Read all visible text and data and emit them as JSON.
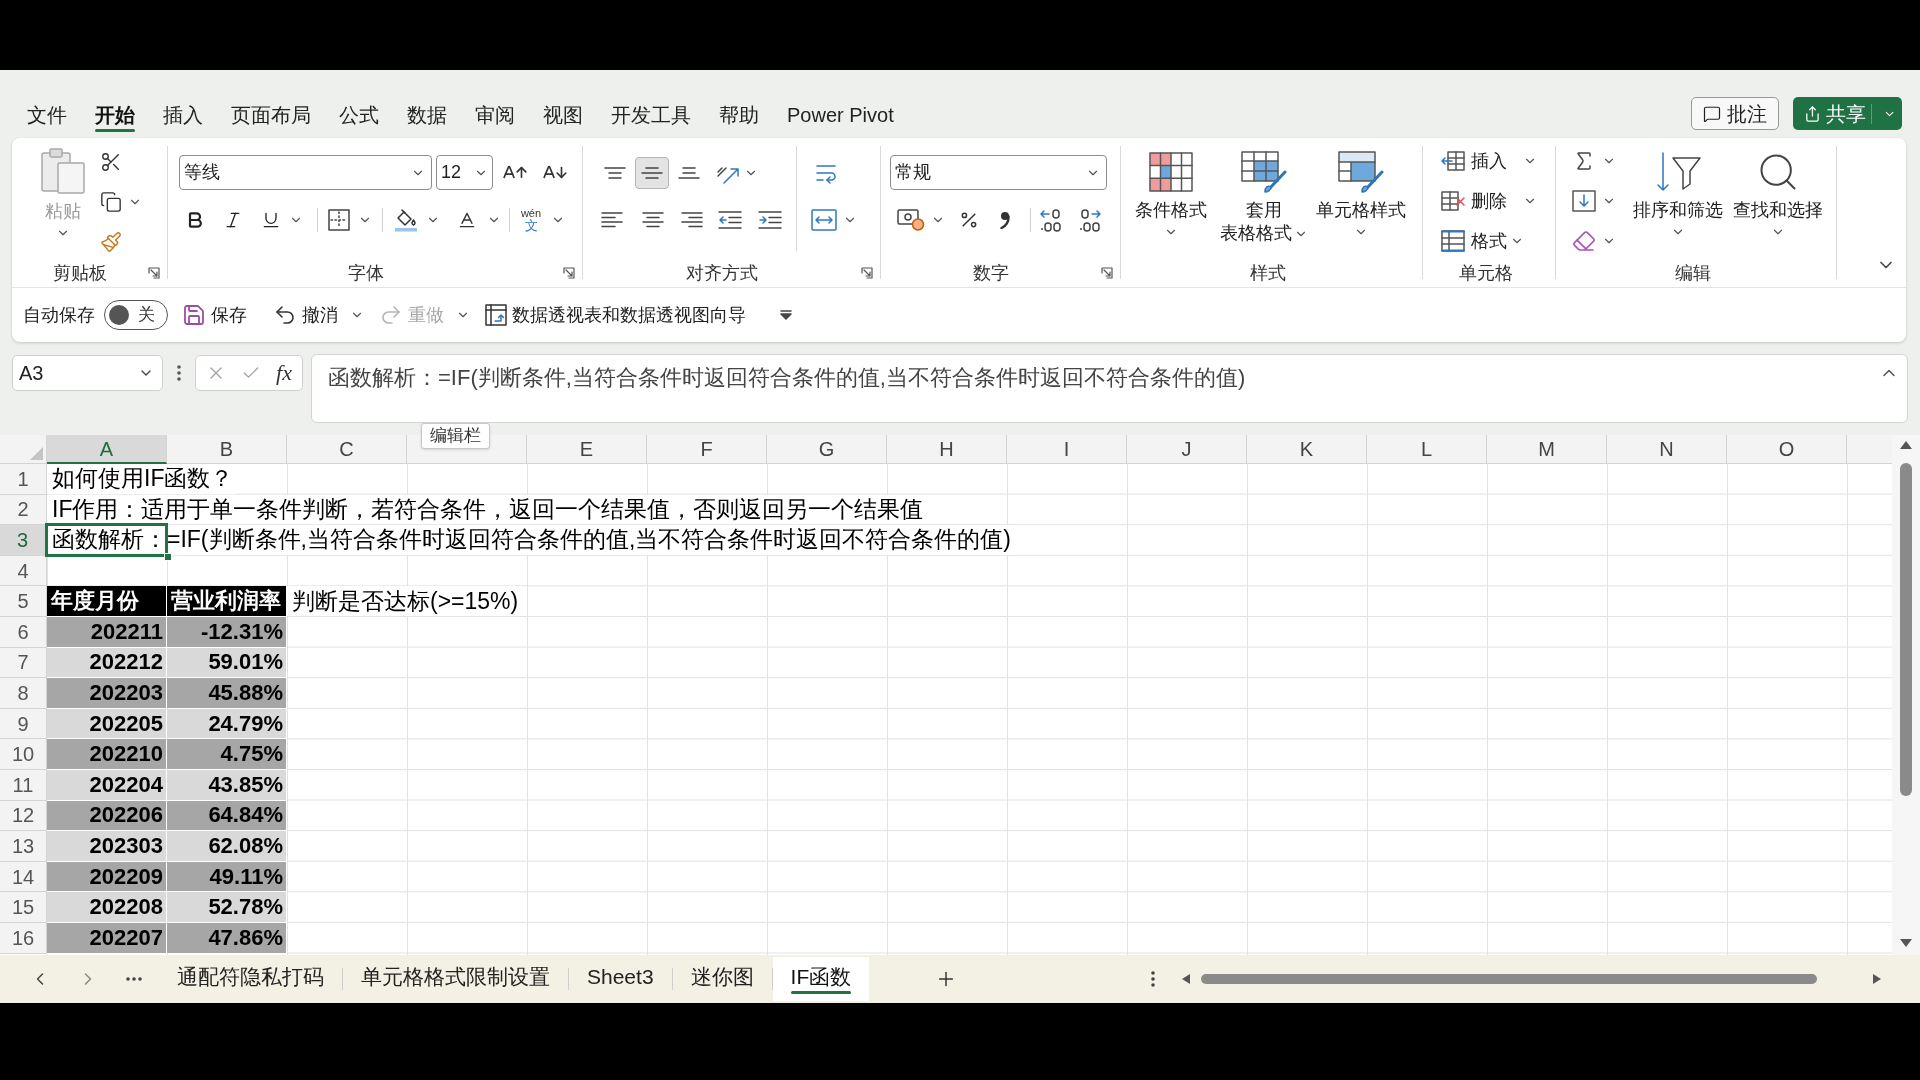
{
  "menu_tabs": [
    {
      "label": "文件",
      "selected": false
    },
    {
      "label": "开始",
      "selected": true
    },
    {
      "label": "插入",
      "selected": false
    },
    {
      "label": "页面布局",
      "selected": false
    },
    {
      "label": "公式",
      "selected": false
    },
    {
      "label": "数据",
      "selected": false
    },
    {
      "label": "审阅",
      "selected": false
    },
    {
      "label": "视图",
      "selected": false
    },
    {
      "label": "开发工具",
      "selected": false
    },
    {
      "label": "帮助",
      "selected": false
    },
    {
      "label": "Power Pivot",
      "selected": false
    }
  ],
  "header_buttons": [
    {
      "kind": "comment",
      "label": "批注"
    },
    {
      "kind": "share",
      "label": "共享"
    }
  ],
  "ribbon": {
    "clipboard": {
      "label": "剪贴板",
      "paste": {
        "label": "粘贴",
        "disabled": true
      }
    },
    "font": {
      "label": "字体",
      "font_name": "等线",
      "font_size": "12",
      "phonetic": {
        "pinyin": "wén",
        "char": "文"
      }
    },
    "alignment": {
      "label": "对齐方式",
      "vertical": [
        {
          "kind": "top",
          "selected": false
        },
        {
          "kind": "middle",
          "selected": true
        },
        {
          "kind": "bottom",
          "selected": false
        }
      ]
    },
    "number": {
      "label": "数字",
      "format": "常规"
    },
    "styles": {
      "label": "样式",
      "buttons": [
        {
          "kind": "conditional",
          "lines": [
            "条件格式"
          ]
        },
        {
          "kind": "table",
          "lines": [
            "套用",
            "表格格式"
          ]
        },
        {
          "kind": "cell_styles",
          "lines": [
            "单元格样式"
          ]
        }
      ]
    },
    "cells": {
      "label": "单元格",
      "buttons": [
        {
          "kind": "insert",
          "label": "插入"
        },
        {
          "kind": "delete",
          "label": "删除"
        },
        {
          "kind": "format",
          "label": "格式"
        }
      ]
    },
    "editing": {
      "label": "编辑",
      "buttons": [
        {
          "kind": "sort_filter",
          "label": "排序和筛选"
        },
        {
          "kind": "find_select",
          "label": "查找和选择"
        }
      ]
    }
  },
  "quick_access": {
    "autosave": {
      "label": "自动保存",
      "on": false,
      "state": "关"
    },
    "items": [
      {
        "kind": "save",
        "label": "保存",
        "disabled": false
      },
      {
        "kind": "undo",
        "label": "撤消",
        "disabled": false
      },
      {
        "kind": "redo",
        "label": "重做",
        "disabled": true
      },
      {
        "kind": "pivot_wizard",
        "label": "数据透视表和数据透视图向导",
        "disabled": false
      }
    ]
  },
  "formula_bar": {
    "name_box": "A3",
    "function_label": "fx",
    "formula": "函数解析：=IF(判断条件,当符合条件时返回符合条件的值,当不符合条件时返回不符合条件的值)",
    "tooltip": "编辑栏"
  },
  "sheet": {
    "columns": [
      {
        "label": "A",
        "selected": true
      },
      {
        "label": "B",
        "selected": false
      },
      {
        "label": "C",
        "selected": false
      },
      {
        "selected": false
      },
      {
        "label": "E",
        "selected": false
      },
      {
        "label": "F",
        "selected": false
      },
      {
        "label": "G",
        "selected": false
      },
      {
        "label": "H",
        "selected": false
      },
      {
        "label": "I",
        "selected": false
      },
      {
        "label": "J",
        "selected": false
      },
      {
        "label": "K",
        "selected": false
      },
      {
        "label": "L",
        "selected": false
      },
      {
        "label": "M",
        "selected": false
      },
      {
        "label": "N",
        "selected": false
      },
      {
        "label": "O",
        "selected": false
      }
    ],
    "rows": [
      {
        "number": "1",
        "selected": false,
        "cells": [
          {
            "kind": "text",
            "text": "如何使用IF函数？",
            "selected": false
          }
        ]
      },
      {
        "number": "2",
        "selected": false,
        "cells": [
          {
            "kind": "text",
            "text": "IF作用：适用于单一条件判断，若符合条件，返回一个结果值，否则返回另一个结果值",
            "selected": false
          }
        ]
      },
      {
        "number": "3",
        "selected": true,
        "cells": [
          {
            "kind": "text",
            "text": "函数解析：=IF(判断条件,当符合条件时返回符合条件的值,当不符合条件时返回不符合条件的值)",
            "selected": true
          }
        ]
      },
      {
        "number": "4",
        "selected": false
      },
      {
        "number": "5",
        "selected": false,
        "cells": [
          {
            "kind": "header",
            "text": "年度月份",
            "selected": false
          },
          {
            "kind": "header",
            "text": "营业利润率",
            "selected": false
          },
          {
            "kind": "text",
            "text": "判断是否达标(>=15%)",
            "selected": false
          }
        ]
      },
      {
        "number": "6",
        "selected": false,
        "cells": [
          {
            "kind": "band_dark",
            "text": "202211",
            "selected": false
          },
          {
            "kind": "band_dark",
            "text": "-12.31%",
            "selected": false
          }
        ]
      },
      {
        "number": "7",
        "selected": false,
        "cells": [
          {
            "kind": "band_light",
            "text": "202212",
            "selected": false
          },
          {
            "kind": "band_light",
            "text": "59.01%",
            "selected": false
          }
        ]
      },
      {
        "number": "8",
        "selected": false,
        "cells": [
          {
            "kind": "band_dark",
            "text": "202203",
            "selected": false
          },
          {
            "kind": "band_dark",
            "text": "45.88%",
            "selected": false
          }
        ]
      },
      {
        "number": "9",
        "selected": false,
        "cells": [
          {
            "kind": "band_light",
            "text": "202205",
            "selected": false
          },
          {
            "kind": "band_light",
            "text": "24.79%",
            "selected": false
          }
        ]
      },
      {
        "number": "10",
        "selected": false,
        "cells": [
          {
            "kind": "band_dark",
            "text": "202210",
            "selected": false
          },
          {
            "kind": "band_dark",
            "text": "4.75%",
            "selected": false
          }
        ]
      },
      {
        "number": "11",
        "selected": false,
        "cells": [
          {
            "kind": "band_light",
            "text": "202204",
            "selected": false
          },
          {
            "kind": "band_light",
            "text": "43.85%",
            "selected": false
          }
        ]
      },
      {
        "number": "12",
        "selected": false,
        "cells": [
          {
            "kind": "band_dark",
            "text": "202206",
            "selected": false
          },
          {
            "kind": "band_dark",
            "text": "64.84%",
            "selected": false
          }
        ]
      },
      {
        "number": "13",
        "selected": false,
        "cells": [
          {
            "kind": "band_light",
            "text": "202303",
            "selected": false
          },
          {
            "kind": "band_light",
            "text": "62.08%",
            "selected": false
          }
        ]
      },
      {
        "number": "14",
        "selected": false,
        "cells": [
          {
            "kind": "band_dark",
            "text": "202209",
            "selected": false
          },
          {
            "kind": "band_dark",
            "text": "49.11%",
            "selected": false
          }
        ]
      },
      {
        "number": "15",
        "selected": false,
        "cells": [
          {
            "kind": "band_light",
            "text": "202208",
            "selected": false
          },
          {
            "kind": "band_light",
            "text": "52.78%",
            "selected": false
          }
        ]
      },
      {
        "number": "16",
        "selected": false,
        "cells": [
          {
            "kind": "band_dark",
            "text": "202207",
            "selected": false
          },
          {
            "kind": "band_dark",
            "text": "47.86%",
            "selected": false
          }
        ]
      }
    ]
  },
  "sheet_tabs": [
    {
      "label": "通配符隐私打码",
      "selected": false
    },
    {
      "label": "单元格格式限制设置",
      "selected": false
    },
    {
      "label": "Sheet3",
      "selected": false
    },
    {
      "label": "迷你图",
      "selected": false
    },
    {
      "label": "IF函数",
      "selected": true
    }
  ]
}
